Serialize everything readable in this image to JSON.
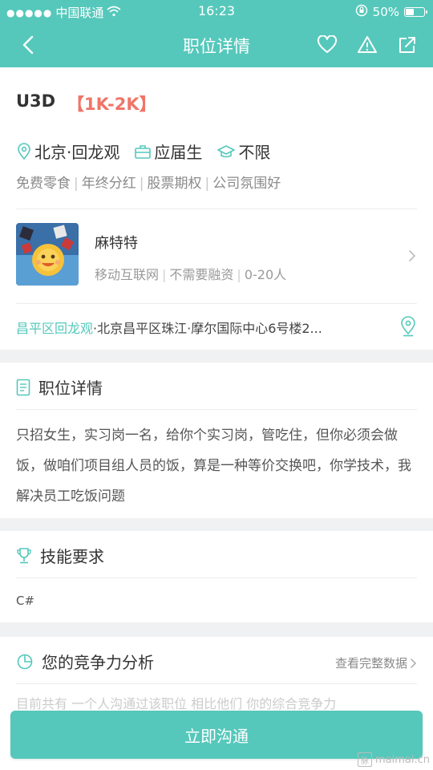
{
  "status_bar": {
    "signal": "●●●●●",
    "carrier": "中国联通",
    "time": "16:23",
    "battery": "50%",
    "battery_level": 0.5
  },
  "nav": {
    "title": "职位详情",
    "icons": [
      "back-icon",
      "heart-icon",
      "warning-icon",
      "share-icon"
    ]
  },
  "job": {
    "title": "U3D",
    "salary": "【1K-2K】",
    "location": "北京·回龙观",
    "education": "应届生",
    "experience": "不限",
    "tags": [
      "免费零食",
      "年终分红",
      "股票期权",
      "公司氛围好"
    ]
  },
  "company": {
    "name": "麻特特",
    "industry": "移动互联网",
    "funding": "不需要融资",
    "size": "0-20人"
  },
  "address": {
    "district": "昌平区回龙观",
    "detail": "·北京昌平区珠江·摩尔国际中心6号楼2..."
  },
  "details": {
    "header": "职位详情",
    "description": "只招女生，实习岗一名，给你个实习岗，管吃住，但你必须会做饭，做咱们项目组人员的饭，算是一种等价交换吧，你学技术，我解决员工吃饭问题"
  },
  "skills": {
    "header": "技能要求",
    "text": "C#"
  },
  "analysis": {
    "header": "您的竞争力分析",
    "view_all": "查看完整数据",
    "faded_text": "目前共有 一个人沟通过该职位 相比他们 你的综合竞争力"
  },
  "bottom_button": "立即沟通",
  "watermark": "maimai.cn",
  "colors": {
    "accent": "#55c8bb",
    "salary": "#ef7568",
    "background": "#f0f1f3"
  }
}
